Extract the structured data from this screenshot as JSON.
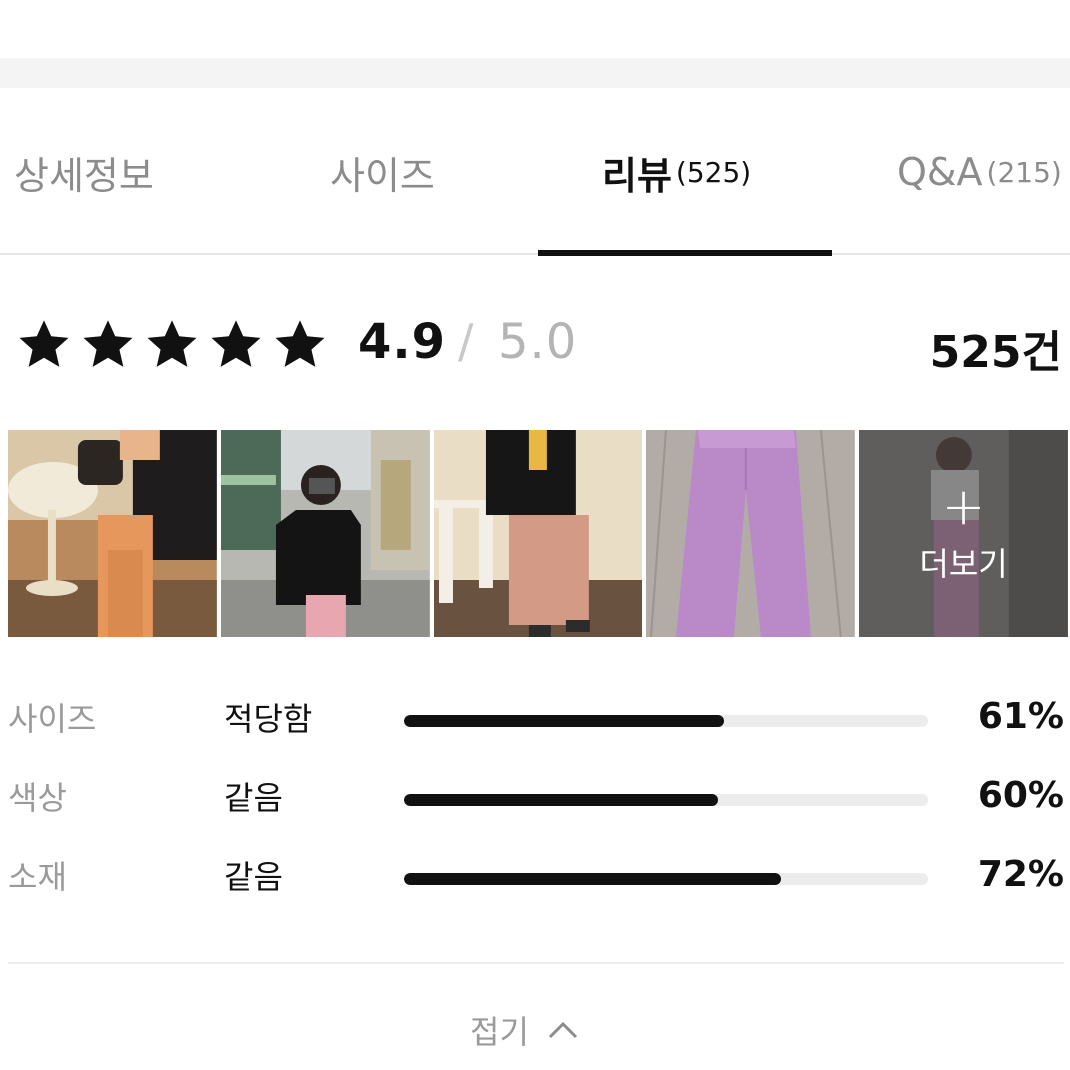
{
  "tabs": [
    {
      "label": "상세정보",
      "count": ""
    },
    {
      "label": "사이즈",
      "count": ""
    },
    {
      "label": "리뷰",
      "count": "(525)"
    },
    {
      "label": "Q&A",
      "count": "(215)"
    }
  ],
  "active_tab": "리뷰",
  "rating": {
    "stars": 5,
    "value": "4.9",
    "separator": "/",
    "max": "5.0",
    "total": "525건"
  },
  "photos": {
    "more_label": "더보기",
    "more_icon": "plus-icon"
  },
  "fit": [
    {
      "name": "사이즈",
      "value": "적당함",
      "percent": "61%",
      "ratio": 0.61
    },
    {
      "name": "색상",
      "value": "같음",
      "percent": "60%",
      "ratio": 0.6
    },
    {
      "name": "소재",
      "value": "같음",
      "percent": "72%",
      "ratio": 0.72
    }
  ],
  "collapse": {
    "label": "접기",
    "icon": "chevron-up-icon"
  },
  "colors": {
    "accent": "#111111",
    "muted": "#9a9a9a",
    "bar_track": "#ececec"
  }
}
